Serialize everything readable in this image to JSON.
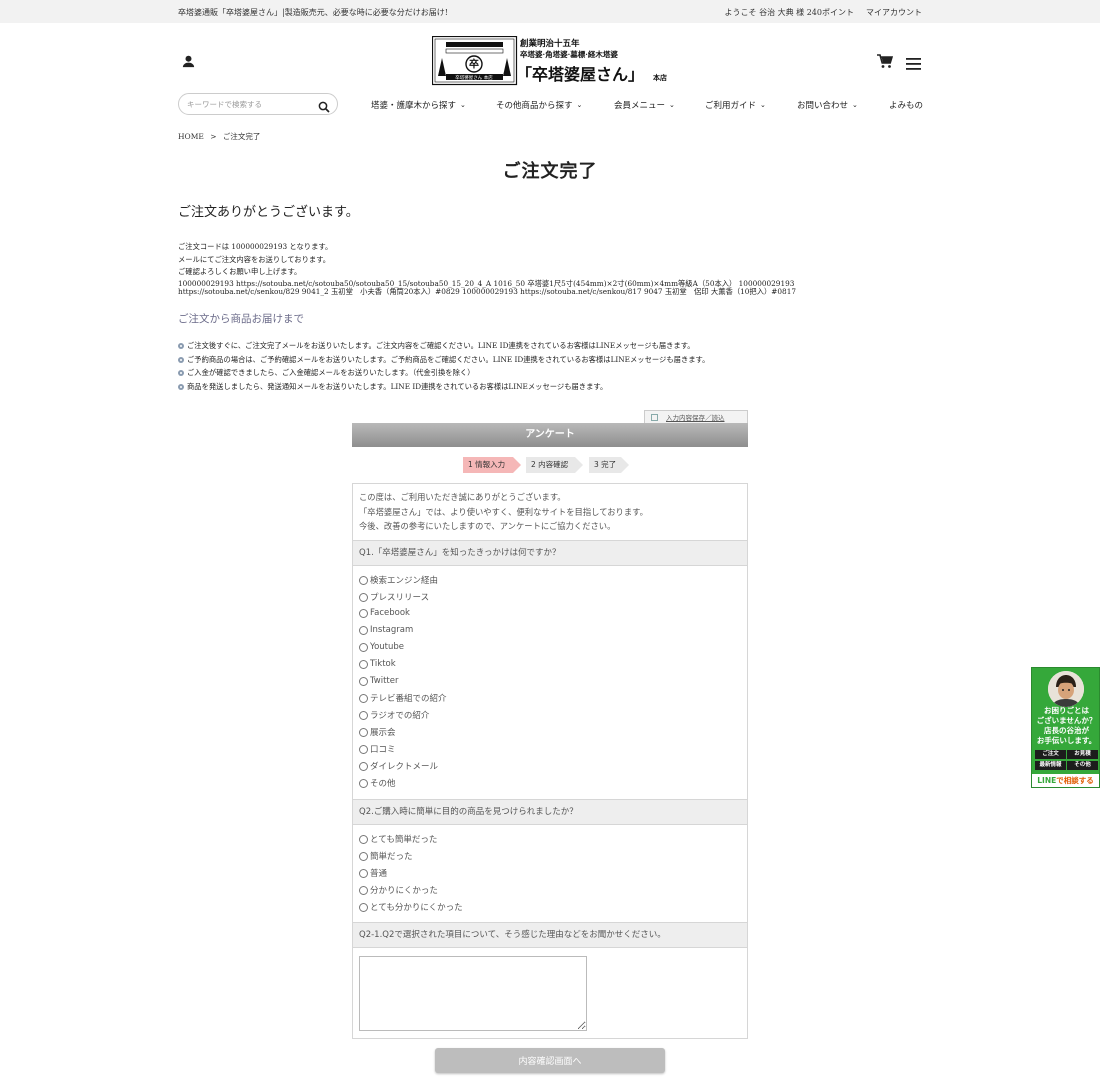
{
  "topbar": {
    "tagline": "卒塔婆通販「卒塔婆屋さん」|製造販売元、必要な時に必要な分だけお届け!",
    "welcome": "ようこそ 谷治 大典 様 240ポイント",
    "my_account": "マイアカウント"
  },
  "logo": {
    "line1": "創業明治十五年",
    "line2": "卒塔婆·角塔婆·墓標·経木塔婆",
    "brand": "「卒塔婆屋さん」",
    "suffix": "本店",
    "seal_text": "卒塔婆屋さん 本店"
  },
  "search": {
    "placeholder": "キーワードで検索する"
  },
  "nav": [
    {
      "label": "塔婆・護摩木から探す"
    },
    {
      "label": "その他商品から探す"
    },
    {
      "label": "会員メニュー"
    },
    {
      "label": "ご利用ガイド"
    },
    {
      "label": "お問い合わせ"
    },
    {
      "label": "よみもの"
    }
  ],
  "breadcrumb": {
    "home": "HOME",
    "sep": ">",
    "current": "ご注文完了"
  },
  "page_title": "ご注文完了",
  "thanks": "ご注文ありがとうございます。",
  "order_info": {
    "line1": "ご注文コードは 100000029193 となります。",
    "line2": "メールにてご注文内容をお送りしております。",
    "line3": "ご確認よろしくお願い申し上げます。",
    "items1": "100000029193 https://sotouba.net/c/sotouba50/sotouba50_15/sotouba50_15_20_4_A 1016_50 卒塔婆1尺5寸(454mm)×2寸(60mm)×4mm等級A（50本入） 100000029193",
    "items2": "https://sotouba.net/c/senkou/829 9041_2 玉初堂　小夫香（角筒20本入）#0829 100000029193 https://sotouba.net/c/senkou/817 9047 玉初堂　侶印 大薫香（10把入）#0817"
  },
  "delivery": {
    "title": "ご注文から商品お届けまで",
    "steps": [
      "ご注文後すぐに、ご注文完了メールをお送りいたします。ご注文内容をご確認ください。LINE ID連携をされているお客様はLINEメッセージも届きます。",
      "ご予約商品の場合は、ご予約確認メールをお送りいたします。ご予約商品をご確認ください。LINE ID連携をされているお客様はLINEメッセージも届きます。",
      "ご入金が確認できましたら、ご入金確認メールをお送りいたします。（代金引換を除く）",
      "商品を発送しましたら、発送通知メールをお送りいたします。LINE ID連携をされているお客様はLINEメッセージも届きます。"
    ]
  },
  "survey": {
    "save_link": "入力内容保存／読込",
    "title": "アンケート",
    "progress": [
      {
        "label": "1 情報入力",
        "active": true
      },
      {
        "label": "2 内容確認",
        "active": false
      },
      {
        "label": "3 完了",
        "active": false
      }
    ],
    "intro": [
      "この度は、ご利用いただき誠にありがとうございます。",
      "「卒塔婆屋さん」では、より使いやすく、便利なサイトを目指しております。",
      "今後、改善の参考にいたしますので、アンケートにご協力ください。"
    ],
    "q1": {
      "label": "Q1.「卒塔婆屋さん」を知ったきっかけは何ですか？",
      "options": [
        "検索エンジン経由",
        "プレスリリース",
        "Facebook",
        "Instagram",
        "Youtube",
        "Tiktok",
        "Twitter",
        "テレビ番組での紹介",
        "ラジオでの紹介",
        "展示会",
        "口コミ",
        "ダイレクトメール",
        "その他"
      ]
    },
    "q2": {
      "label": "Q2.ご購入時に簡単に目的の商品を見つけられましたか？",
      "options": [
        "とても簡単だった",
        "簡単だった",
        "普通",
        "分かりにくかった",
        "とても分かりにくかった"
      ]
    },
    "q2_1": {
      "label": "Q2-1.Q2で選択された項目について、そう感じた理由などをお聞かせください。"
    },
    "submit": "内容確認画面へ"
  },
  "line_widget": {
    "message": [
      "お困りごとは",
      "ございませんか？",
      "店長の谷治が",
      "お手伝いします。"
    ],
    "chips": [
      "ご注文",
      "お見積",
      "最新情報",
      "その他"
    ],
    "cta_line": "LINE",
    "cta_rest": "で相談する"
  },
  "colors": {
    "topbar_bg": "#f2f2f2",
    "accent_step": "#f5b7b7",
    "line_green": "#35a83a",
    "submit_disabled": "#bdbdbd"
  }
}
